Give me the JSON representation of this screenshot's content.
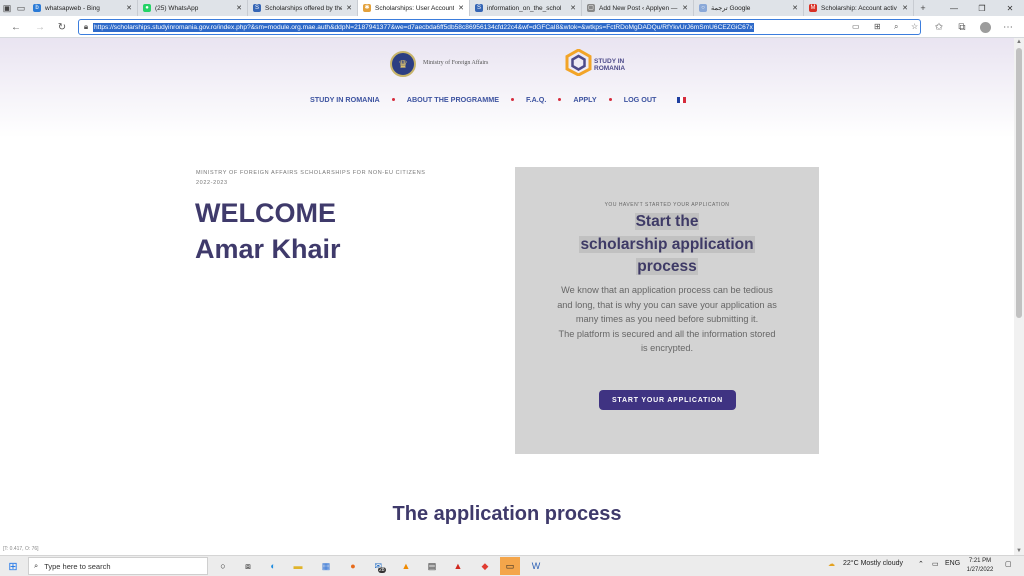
{
  "browser": {
    "tabs": [
      {
        "title": "whatsapweb - Bing",
        "color": "#2a7ad6",
        "glyph": "b"
      },
      {
        "title": "(25) WhatsApp",
        "color": "#25d366",
        "glyph": "●"
      },
      {
        "title": "Scholarships offered by the",
        "color": "#3565b5",
        "glyph": "S"
      },
      {
        "title": "Scholarships: User Account",
        "color": "#e3a13b",
        "glyph": "✱"
      },
      {
        "title": "information_on_the_schol",
        "color": "#3565b5",
        "glyph": "S"
      },
      {
        "title": "Add New Post ‹ Applyen —",
        "color": "#888888",
        "glyph": "▢"
      },
      {
        "title": "ترجمة Google",
        "color": "#8aa8d8",
        "glyph": "○"
      },
      {
        "title": "Scholarship: Account activ",
        "color": "#d93025",
        "glyph": "M"
      }
    ],
    "url": "https://scholarships.studyinromania.gov.ro/index.php?&sm=module.org.mae.auth&ddpN=2187941377&we=d7aecbda6ff5db58c86956134cfd22c4&wf=dGFCaI8&wtok=&wtkps=FctRDoMgDADQu/RfYkvUrJ6mSmU6CEZGiC67x"
  },
  "header": {
    "ministry": "Ministry of Foreign Affairs",
    "brand_line1": "STUDY IN",
    "brand_line2": "ROMANIA",
    "menu": [
      "STUDY IN ROMANIA",
      "ABOUT THE PROGRAMME",
      "F.A.Q.",
      "APPLY",
      "LOG OUT"
    ]
  },
  "welcome": {
    "subtitle": "MINISTRY OF FOREIGN AFFAIRS SCHOLARSHIPS FOR NON-EU CITIZENS",
    "year": "2022-2023",
    "greeting": "WELCOME",
    "name": "Amar Khair"
  },
  "card": {
    "note": "YOU HAVEN'T STARTED YOUR APPLICATION",
    "title_l1": "Start the",
    "title_l2": "scholarship application",
    "title_l3": "process",
    "desc": "We know that an application process can be tedious and long, that is why you can save your application as many times as you need before submitting it.",
    "desc2": "The platform is secured and all the information stored is encrypted.",
    "button": "START YOUR APPLICATION"
  },
  "process_title": "The application process",
  "coords_text": "[T: 0.417, O: 76]",
  "taskbar": {
    "search_placeholder": "Type here to search",
    "weather": "22°C  Mostly cloudy",
    "lang": "ENG",
    "time": "7:21 PM",
    "date": "1/27/2022",
    "badge": "28"
  }
}
